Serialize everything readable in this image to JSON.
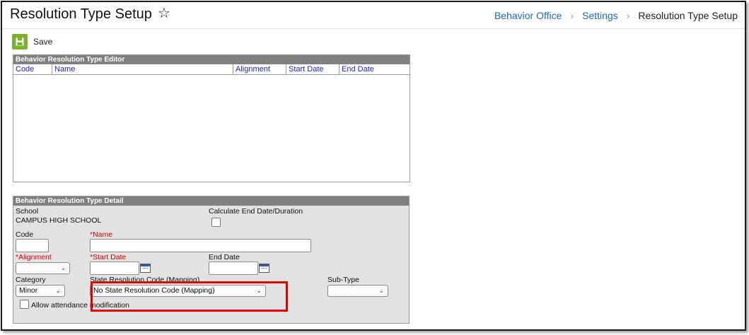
{
  "header": {
    "title": "Resolution Type Setup",
    "breadcrumb": [
      "Behavior Office",
      "Settings",
      "Resolution Type Setup"
    ]
  },
  "toolbar": {
    "save_label": "Save"
  },
  "editor": {
    "title": "Behavior Resolution Type Editor",
    "columns": [
      "Code",
      "Name",
      "Alignment",
      "Start Date",
      "End Date"
    ]
  },
  "detail": {
    "title": "Behavior Resolution Type Detail",
    "school_label": "School",
    "school_value": "CAMPUS HIGH SCHOOL",
    "calc_label": "Calculate End Date/Duration",
    "code_label": "Code",
    "code_value": "",
    "name_label": "Name",
    "name_value": "",
    "alignment_label": "Alignment",
    "alignment_value": "",
    "start_label": "Start Date",
    "start_value": "",
    "end_label": "End Date",
    "end_value": "",
    "category_label": "Category",
    "category_value": "Minor",
    "state_label": "State Resolution Code (Mapping)",
    "state_value": "No State Resolution Code (Mapping)",
    "subtype_label": "Sub-Type",
    "subtype_value": "",
    "allow_label": "Allow attendance modification",
    "required_marker": "*"
  },
  "colors": {
    "accent_link": "#1f6bb0",
    "save_green": "#7cb32e",
    "header_gray": "#808080",
    "required_red": "#e00000",
    "column_blue": "#2323c8"
  }
}
